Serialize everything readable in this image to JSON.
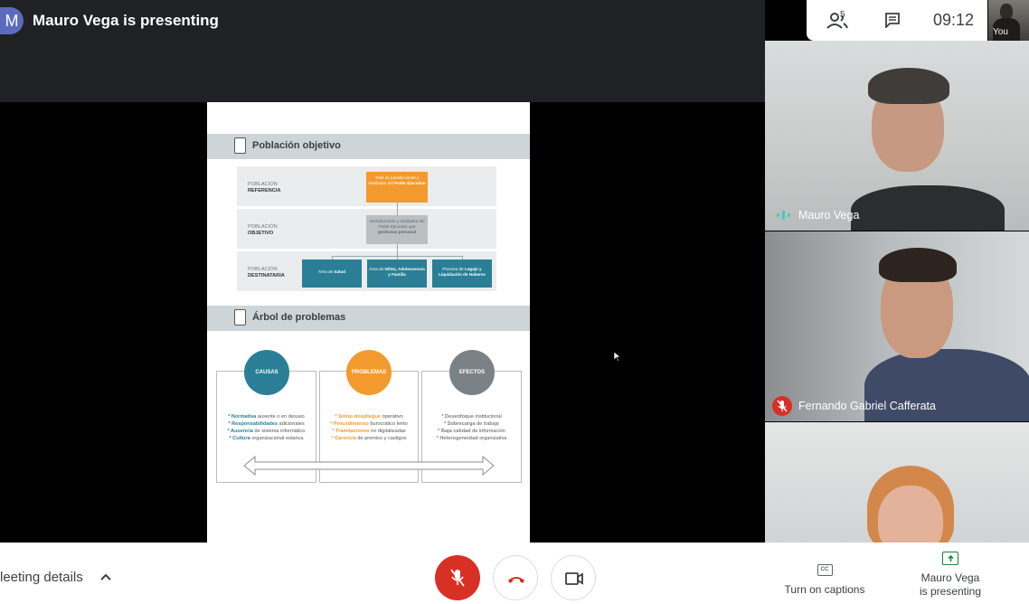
{
  "header": {
    "avatar_letter": "M",
    "presenting_title": "Mauro Vega is presenting",
    "participants_count": "5",
    "clock": "09:12",
    "self_label": "You"
  },
  "slide": {
    "section1_title": "Población objetivo",
    "rows": [
      {
        "label_top": "POBLACIÓN",
        "label_bottom": "REFERENCIA",
        "box_text": "Total de jurisdicciones y entidades del",
        "box_bold": "Poder Ejecutivo"
      },
      {
        "label_top": "POBLACIÓN",
        "label_bottom": "OBJETIVO",
        "box_text": "Jurisdicciones y entidades del Poder Ejecutivo que",
        "box_bold": "gestionan personal"
      },
      {
        "label_top": "POBLACIÓN",
        "label_bottom": "DESTINATARIA"
      }
    ],
    "dest_boxes": [
      {
        "text": "Área de",
        "bold": "Salud"
      },
      {
        "text": "Área de",
        "bold": "Niñez, Adolescencia y Familia"
      },
      {
        "text": "Proceso de",
        "bold": "Legajo y Liquidación de Haberes"
      }
    ],
    "section2_title": "Árbol de problemas",
    "columns": [
      {
        "title": "CAUSAS",
        "items": [
          {
            "b": "* Normativa",
            "t": " ausente o en desuso"
          },
          {
            "b": "* Responsabilidades",
            "t": " adicionales"
          },
          {
            "b": "* Ausencia",
            "t": " de sistema informático"
          },
          {
            "b": "* Cultura",
            "t": " organizacional estanca"
          }
        ]
      },
      {
        "title": "PROBLEMAS",
        "items": [
          {
            "b": "* Sobre-despliegue",
            "t": " operativo"
          },
          {
            "b": "* Procedimiento",
            "t": " burocrático lento"
          },
          {
            "b": "* Tramitaciones",
            "t": " no digitalizadas"
          },
          {
            "b": "* Carencia",
            "t": " de premios y castigos"
          }
        ]
      },
      {
        "title": "EFECTOS",
        "items": [
          {
            "b": "* Desenfoque",
            "t": " institucional"
          },
          {
            "b": "* Sobrecarga",
            "t": " de trabajo"
          },
          {
            "b": "* Baja calidad",
            "t": " de información"
          },
          {
            "b": "* Heterogeneidad",
            "t": " organizativa"
          }
        ]
      }
    ]
  },
  "participants": [
    {
      "name": "Mauro Vega",
      "status": "speaking"
    },
    {
      "name": "Fernando Gabriel Cafferata",
      "status": "muted"
    },
    {
      "name": "",
      "status": ""
    }
  ],
  "bottom": {
    "meeting_details": "leeting details",
    "captions_label": "Turn on captions",
    "captions_icon": "CC",
    "presenting_label_line1": "Mauro Vega",
    "presenting_label_line2": "is presenting"
  },
  "colors": {
    "end_call_red": "#d93025",
    "slide_orange": "#f39a2e",
    "slide_teal": "#2a7f96",
    "slide_grey": "#7a8287",
    "present_green": "#188038"
  }
}
